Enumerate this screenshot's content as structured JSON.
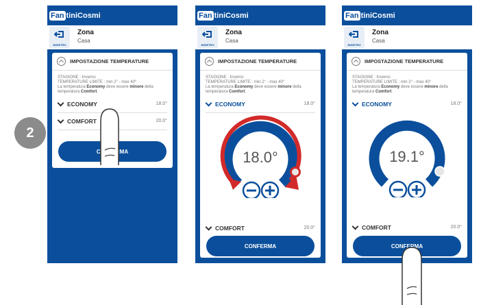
{
  "step": "2",
  "brand": {
    "logo": "Fan",
    "name": "tiniCosmi"
  },
  "zone": {
    "title": "Zona",
    "subtitle": "Casa",
    "back_label": "INDIETRO"
  },
  "panel": {
    "title": "IMPOSTAZIONE TEMPERATURE",
    "season_line": "STAGIONE : Inverno",
    "limits_line": "TEMPERATURE LIMITE : min 2° - max 40°",
    "note_pre": "La temperatura ",
    "note_economy": "Economy",
    "note_mid": " deve essere ",
    "note_minor": "minore",
    "note_post": " della temperatura ",
    "note_comfort": "Comfort",
    "note_end": "."
  },
  "screens": [
    {
      "economy_label": "ECONOMY",
      "economy_value": "18.0°",
      "comfort_label": "COMFORT",
      "comfort_value": "20.0°",
      "confirm_label": "CONFERMA"
    },
    {
      "economy_label": "ECONOMY",
      "economy_value": "18.0°",
      "dial_value": "18.0°",
      "comfort_label": "COMFORT",
      "comfort_value": "20.0°",
      "confirm_label": "CONFERMA"
    },
    {
      "economy_label": "ECONOMY",
      "economy_value": "18.0°",
      "dial_value": "19.1°",
      "comfort_label": "COMFORT",
      "comfort_value": "20.0°",
      "confirm_label": "CONFERMA"
    }
  ],
  "colors": {
    "brand_blue": "#0b4f9c",
    "guide_red": "#d22a2a",
    "badge_gray": "#8b8b8b"
  }
}
